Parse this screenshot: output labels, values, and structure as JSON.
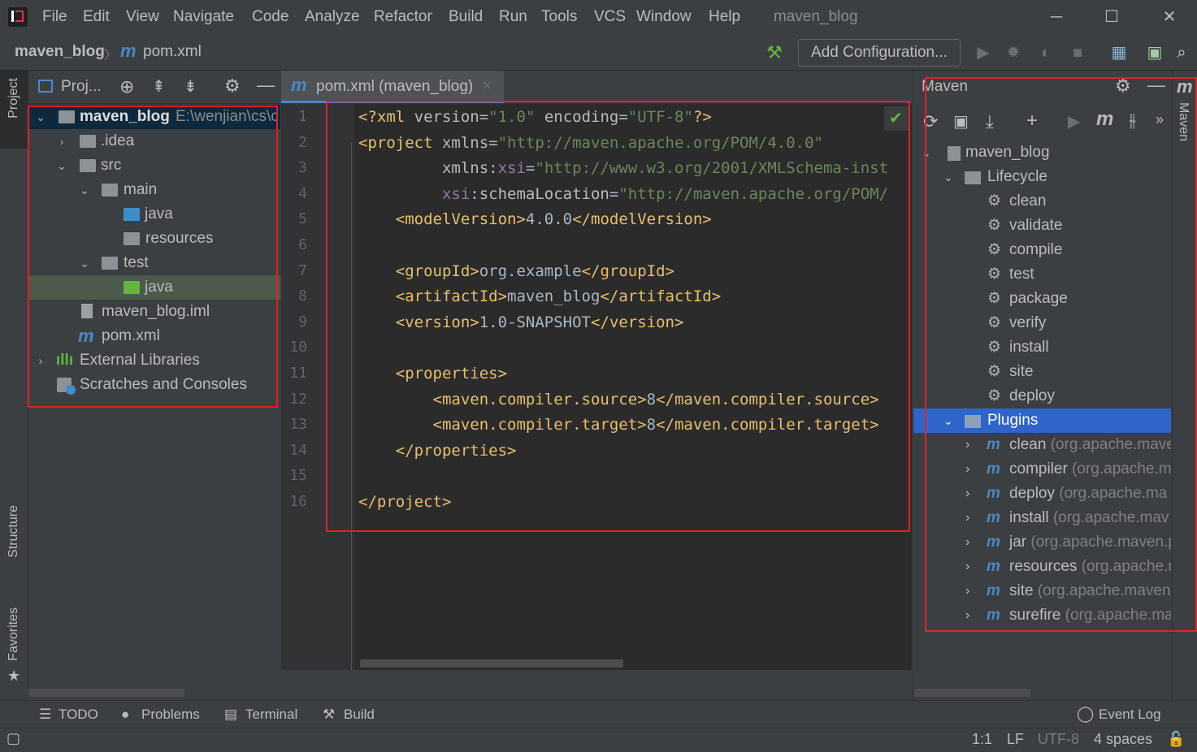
{
  "menubar": {
    "items": [
      "File",
      "Edit",
      "View",
      "Navigate",
      "Code",
      "Analyze",
      "Refactor",
      "Build",
      "Run",
      "Tools",
      "VCS",
      "Window",
      "Help"
    ],
    "window_title": "maven_blog",
    "minimize": "─",
    "maximize": "☐",
    "close": "✕"
  },
  "navbar": {
    "project": "maven_blog",
    "separator": "〉",
    "file": "pom.xml",
    "add_configuration": "Add Configuration..."
  },
  "left_stripe": {
    "project": "Project",
    "structure": "Structure",
    "favorites": "Favorites"
  },
  "project_panel": {
    "header": "Proj...",
    "tree": [
      {
        "label": "maven_blog",
        "path": "E:\\wenjian\\cs\\c"
      },
      {
        "label": ".idea"
      },
      {
        "label": "src"
      },
      {
        "label": "main"
      },
      {
        "label": "java"
      },
      {
        "label": "resources"
      },
      {
        "label": "test"
      },
      {
        "label": "java"
      },
      {
        "label": "maven_blog.iml"
      },
      {
        "label": "pom.xml"
      },
      {
        "label": "External Libraries"
      },
      {
        "label": "Scratches and Consoles"
      }
    ]
  },
  "editor": {
    "tab_label": "pom.xml (maven_blog)",
    "tab_close": "×",
    "line_numbers": [
      "1",
      "2",
      "3",
      "4",
      "5",
      "6",
      "7",
      "8",
      "9",
      "10",
      "11",
      "12",
      "13",
      "14",
      "15",
      "16"
    ],
    "lines": [
      {
        "parts": [
          [
            "tg",
            "<?xml "
          ],
          [
            "at",
            "version"
          ],
          [
            "plain",
            "="
          ],
          [
            "av",
            "\"1.0\""
          ],
          [
            "plain",
            " "
          ],
          [
            "at",
            "encoding"
          ],
          [
            "plain",
            "="
          ],
          [
            "av",
            "\"UTF-8\""
          ],
          [
            "tg",
            "?>"
          ]
        ]
      },
      {
        "parts": [
          [
            "tg",
            "<project "
          ],
          [
            "at",
            "xmlns"
          ],
          [
            "plain",
            "="
          ],
          [
            "av",
            "\"http://maven.apache.org/POM/4.0.0\""
          ]
        ]
      },
      {
        "parts": [
          [
            "plain",
            "         "
          ],
          [
            "at",
            "xmlns:"
          ],
          [
            "ns",
            "xsi"
          ],
          [
            "plain",
            "="
          ],
          [
            "av",
            "\"http://www.w3.org/2001/XMLSchema-inst"
          ]
        ]
      },
      {
        "parts": [
          [
            "plain",
            "         "
          ],
          [
            "ns",
            "xsi"
          ],
          [
            "at",
            ":schemaLocation"
          ],
          [
            "plain",
            "="
          ],
          [
            "av",
            "\"http://maven.apache.org/POM/"
          ]
        ]
      },
      {
        "parts": [
          [
            "plain",
            "    "
          ],
          [
            "tg",
            "<modelVersion>"
          ],
          [
            "plain",
            "4.0.0"
          ],
          [
            "tg",
            "</modelVersion>"
          ]
        ]
      },
      {
        "parts": []
      },
      {
        "parts": [
          [
            "plain",
            "    "
          ],
          [
            "tg",
            "<groupId>"
          ],
          [
            "plain",
            "org.example"
          ],
          [
            "tg",
            "</groupId>"
          ]
        ]
      },
      {
        "parts": [
          [
            "plain",
            "    "
          ],
          [
            "tg",
            "<artifactId>"
          ],
          [
            "plain",
            "maven_blog"
          ],
          [
            "tg",
            "</artifactId>"
          ]
        ]
      },
      {
        "parts": [
          [
            "plain",
            "    "
          ],
          [
            "tg",
            "<version>"
          ],
          [
            "plain",
            "1.0-SNAPSHOT"
          ],
          [
            "tg",
            "</version>"
          ]
        ]
      },
      {
        "parts": []
      },
      {
        "parts": [
          [
            "plain",
            "    "
          ],
          [
            "tg",
            "<properties>"
          ]
        ]
      },
      {
        "parts": [
          [
            "plain",
            "        "
          ],
          [
            "tg",
            "<maven.compiler.source>"
          ],
          [
            "plain",
            "8"
          ],
          [
            "tg",
            "</maven.compiler.source>"
          ]
        ]
      },
      {
        "parts": [
          [
            "plain",
            "        "
          ],
          [
            "tg",
            "<maven.compiler.target>"
          ],
          [
            "plain",
            "8"
          ],
          [
            "tg",
            "</maven.compiler.target>"
          ]
        ]
      },
      {
        "parts": [
          [
            "plain",
            "    "
          ],
          [
            "tg",
            "</properties>"
          ]
        ]
      },
      {
        "parts": []
      },
      {
        "parts": [
          [
            "tg",
            "</project>"
          ]
        ]
      }
    ]
  },
  "maven_panel": {
    "title": "Maven",
    "root": "maven_blog",
    "lifecycle_label": "Lifecycle",
    "lifecycle": [
      "clean",
      "validate",
      "compile",
      "test",
      "package",
      "verify",
      "install",
      "site",
      "deploy"
    ],
    "plugins_label": "Plugins",
    "plugins": [
      {
        "name": "clean",
        "group": "(org.apache.mave"
      },
      {
        "name": "compiler",
        "group": "(org.apache.m"
      },
      {
        "name": "deploy",
        "group": "(org.apache.ma"
      },
      {
        "name": "install",
        "group": "(org.apache.mav"
      },
      {
        "name": "jar",
        "group": "(org.apache.maven.p"
      },
      {
        "name": "resources",
        "group": "(org.apache.r"
      },
      {
        "name": "site",
        "group": "(org.apache.maven"
      },
      {
        "name": "surefire",
        "group": "(org.apache.ma"
      }
    ],
    "stripe_label": "Maven"
  },
  "bottom_tools": {
    "todo": "TODO",
    "problems": "Problems",
    "terminal": "Terminal",
    "build": "Build",
    "event_log": "Event Log"
  },
  "status": {
    "position": "1:1",
    "line_sep": "LF",
    "encoding": "UTF-8",
    "indent": "4 spaces"
  },
  "colors": {
    "accent": "#2f65ca",
    "annotation_box": "#e0212a",
    "tag": "#e8bf6a",
    "attr_value": "#6a8759"
  }
}
